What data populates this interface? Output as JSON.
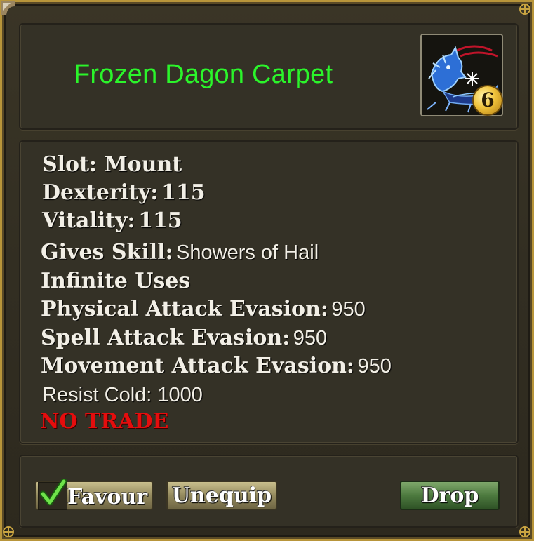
{
  "item": {
    "name": "Frozen Dagon Carpet",
    "level_badge": "6",
    "icon": "ice-dragon-mount-icon"
  },
  "stats": {
    "slot_label": "Slot: Mount",
    "dexterity_label": "Dexterity:",
    "dexterity_value": "115",
    "vitality_label": "Vitality:",
    "vitality_value": "115",
    "gives_skill_label": "Gives Skill:",
    "gives_skill_value": "Showers of Hail",
    "infinite_uses": "Infinite Uses",
    "physical_evasion_label": "Physical Attack Evasion:",
    "physical_evasion_value": "950",
    "spell_evasion_label": "Spell Attack Evasion:",
    "spell_evasion_value": "950",
    "movement_evasion_label": "Movement Attack Evasion:",
    "movement_evasion_value": "950",
    "resist_cold": "Resist Cold: 1000",
    "no_trade": "NO TRADE"
  },
  "actions": {
    "favour_label": "Favour",
    "favour_checked": true,
    "unequip_label": "Unequip",
    "drop_label": "Drop"
  },
  "colors": {
    "item_name": "#2bf52b",
    "no_trade": "#e50d0d",
    "frame_gold": "#b8953a",
    "drop_button": "#4d7a3f",
    "tan_button": "#948a5e"
  }
}
